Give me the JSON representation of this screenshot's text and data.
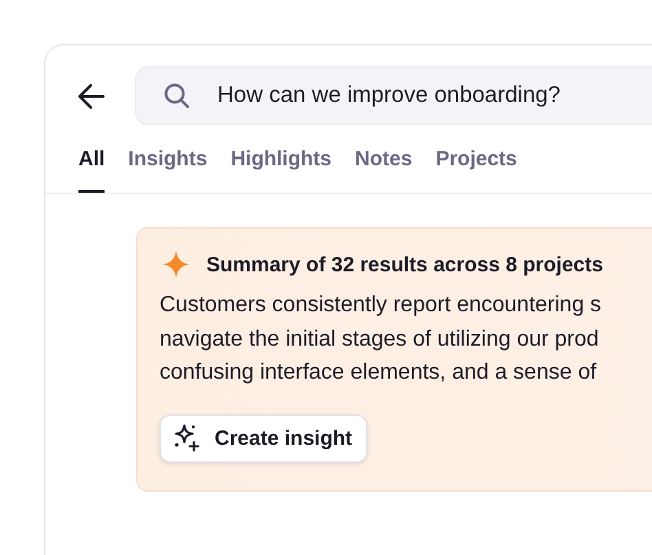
{
  "search": {
    "value": "How can we improve onboarding?"
  },
  "tabs": [
    {
      "label": "All",
      "selected": true
    },
    {
      "label": "Insights",
      "selected": false
    },
    {
      "label": "Highlights",
      "selected": false
    },
    {
      "label": "Notes",
      "selected": false
    },
    {
      "label": "Projects",
      "selected": false
    }
  ],
  "summary": {
    "title": "Summary of 32 results across 8 projects",
    "lines": [
      "Customers consistently report encountering s",
      "navigate the initial stages of utilizing our prod",
      "confusing interface elements, and a sense of"
    ],
    "button": "Create insight"
  }
}
